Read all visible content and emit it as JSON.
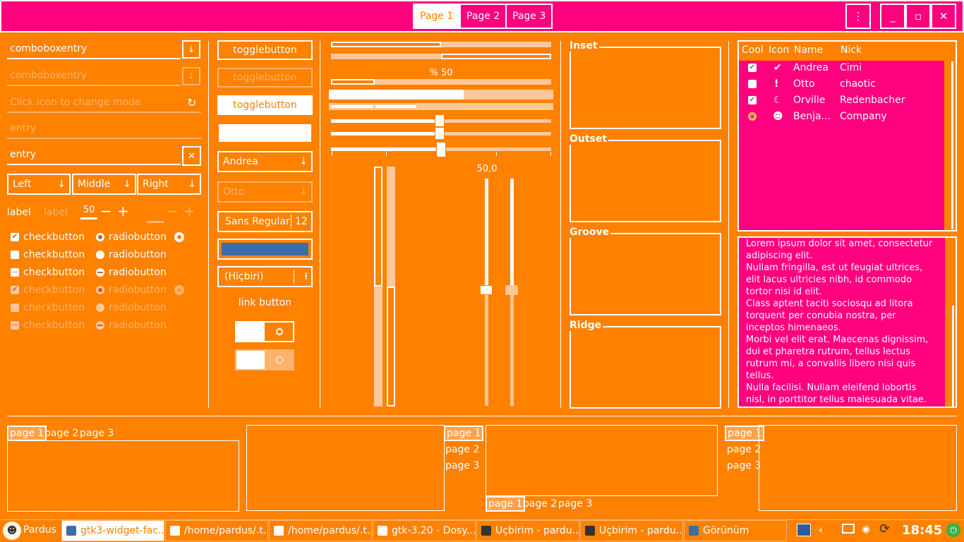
{
  "header": {
    "tabs": [
      "Page 1",
      "Page 2",
      "Page 3"
    ],
    "menu_icon": "kebab-menu-icon",
    "min_icon": "minimize-icon",
    "max_icon": "maximize-icon",
    "close_icon": "close-icon"
  },
  "col1": {
    "combo1": "comboboxentry",
    "combo2": "comboboxentry",
    "icon_entry_placeholder": "Click icon to change mode",
    "entry_placeholder": "entry",
    "entry_value": "entry",
    "combos": [
      "Left",
      "Middle",
      "Right"
    ],
    "label": "label",
    "label_dim": "label",
    "spin_value": "50",
    "checks": [
      "checkbutton",
      "checkbutton",
      "checkbutton",
      "checkbutton",
      "checkbutton",
      "checkbutton"
    ],
    "radios": [
      "radiobutton",
      "radiobutton",
      "radiobutton",
      "radiobutton",
      "radiobutton",
      "radiobutton"
    ]
  },
  "col2": {
    "toggle1": "togglebutton",
    "toggle2": "togglebutton",
    "toggle3": "togglebutton",
    "combo_andrea": "Andrea",
    "combo_otto": "Otto",
    "font_name": "Sans Regular",
    "font_size": "12",
    "color": "#3a6ea5",
    "file": "(Hiçbiri)",
    "link": "link button"
  },
  "col3": {
    "progress_label": "% 50",
    "scale_value": "50,0",
    "progress": 0.5
  },
  "frames": [
    "Inset",
    "Outset",
    "Groove",
    "Ridge"
  ],
  "tree": {
    "headers": [
      "Cool",
      "Icon",
      "Name",
      "Nick"
    ],
    "rows": [
      {
        "name": "Andrea",
        "nick": "Cimi",
        "icon": "check-circle-icon"
      },
      {
        "name": "Otto",
        "nick": "chaotic",
        "icon": "warning-icon"
      },
      {
        "name": "Orville",
        "nick": "Redenbacher",
        "icon": "moon-icon"
      },
      {
        "name": "Benja...",
        "nick": "Company",
        "icon": "face-icon"
      }
    ]
  },
  "textview": [
    "Lorem ipsum dolor sit amet, consectetur",
    "adipiscing elit.",
    "Nullam fringilla, est ut feugiat ultrices,",
    "elit lacus ultricies nibh, id commodo",
    "tortor nisi id elit.",
    "Class aptent taciti sociosqu ad litora",
    "torquent per conubia nostra, per",
    "inceptos himenaeos.",
    "Morbi vel elit erat. Maecenas dignissim,",
    "dui et pharetra rutrum, tellus lectus",
    "rutrum mi, a convallis libero nisi quis",
    "tellus.",
    "Nulla facilisi. Nullam eleifend lobortis",
    "nisl, in porttitor tellus malesuada vitae."
  ],
  "notebooks": [
    "page 1",
    "page 2",
    "page 3"
  ],
  "taskbar": {
    "start": "Pardus",
    "tasks": [
      "gtk3-widget-fac...",
      "/home/pardus/.t...",
      "/home/pardus/.t...",
      "gtk-3.20 - Dosy...",
      "Uçbirim - pardu...",
      "Uçbirim - pardu...",
      "Görünüm"
    ],
    "clock": "18:45"
  }
}
